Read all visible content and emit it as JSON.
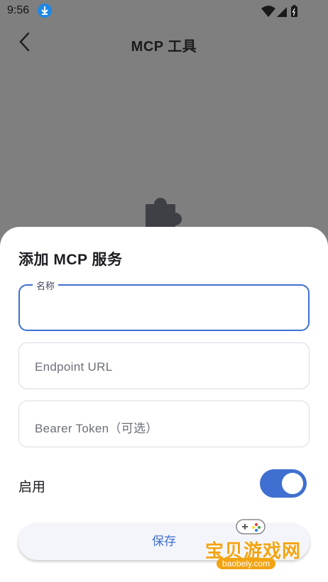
{
  "status_bar": {
    "time": "9:56",
    "icons": [
      "download-icon",
      "wifi-icon",
      "signal-icon",
      "battery-icon"
    ]
  },
  "app_bar": {
    "title": "MCP 工具",
    "back_icon": "chevron-left-icon"
  },
  "background": {
    "empty_state_icon": "puzzle-icon"
  },
  "sheet": {
    "title": "添加 MCP 服务",
    "fields": [
      {
        "name": "name-field",
        "label": "名称",
        "value": "",
        "focused": true
      },
      {
        "name": "endpoint-field",
        "placeholder": "Endpoint URL",
        "value": ""
      },
      {
        "name": "bearer-token-field",
        "placeholder": "Bearer Token（可选）",
        "value": ""
      }
    ],
    "enable_label": "启用",
    "enabled": true,
    "save_label": "保存"
  },
  "watermark": {
    "text": "宝贝游戏网",
    "site": "baobeiy.com"
  },
  "colors": {
    "accent": "#3f6fd0",
    "scrim": "#7f7f7f",
    "watermark": "#f2a413"
  }
}
